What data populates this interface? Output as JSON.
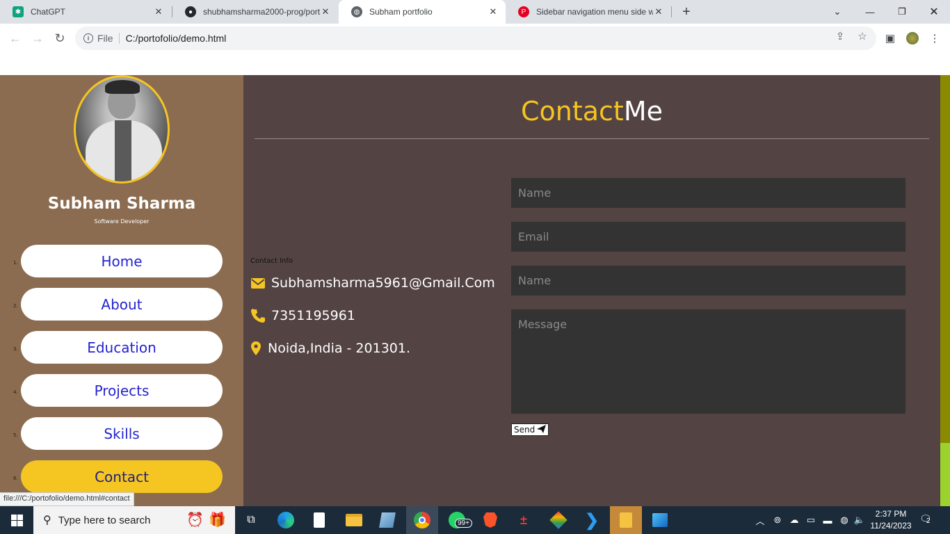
{
  "browser": {
    "tabs": [
      {
        "title": "ChatGPT",
        "active": false
      },
      {
        "title": "shubhamsharma2000-prog/port",
        "active": false
      },
      {
        "title": "Subham portfolio",
        "active": true
      },
      {
        "title": "Sidebar navigation menu side w",
        "active": false
      }
    ],
    "address": {
      "scheme": "File",
      "url": "C:/portofolio/demo.html"
    },
    "status_url": "file:///C:/portofolio/demo.html#contact"
  },
  "profile": {
    "name": "Subham Sharma",
    "role": "Software Developer"
  },
  "nav": {
    "items": [
      {
        "num": "1.",
        "label": "Home"
      },
      {
        "num": "2.",
        "label": "About"
      },
      {
        "num": "3.",
        "label": "Education"
      },
      {
        "num": "4.",
        "label": "Projects"
      },
      {
        "num": "5.",
        "label": "Skills"
      },
      {
        "num": "6.",
        "label": "Contact"
      }
    ],
    "active_item": "Contact"
  },
  "contact": {
    "title_accent": "Contact",
    "title_rest": "Me",
    "info_label": "Contact Info",
    "email": "Subhamsharma5961@Gmail.Com",
    "phone": "7351195961",
    "address": "Noida,India - 201301.",
    "form": {
      "name_placeholder": "Name",
      "email_placeholder": "Email",
      "subject_placeholder": "Name",
      "message_placeholder": "Message",
      "send_label": "Send"
    }
  },
  "taskbar": {
    "search_placeholder": "Type here to search",
    "time": "2:37 PM",
    "date": "11/24/2023",
    "whatsapp_badge": "99+",
    "notification_count": "2"
  },
  "colors": {
    "accent": "#f5c522",
    "sidebar": "#8b6c50",
    "content": "#534343",
    "nav_text": "#2323d0"
  }
}
